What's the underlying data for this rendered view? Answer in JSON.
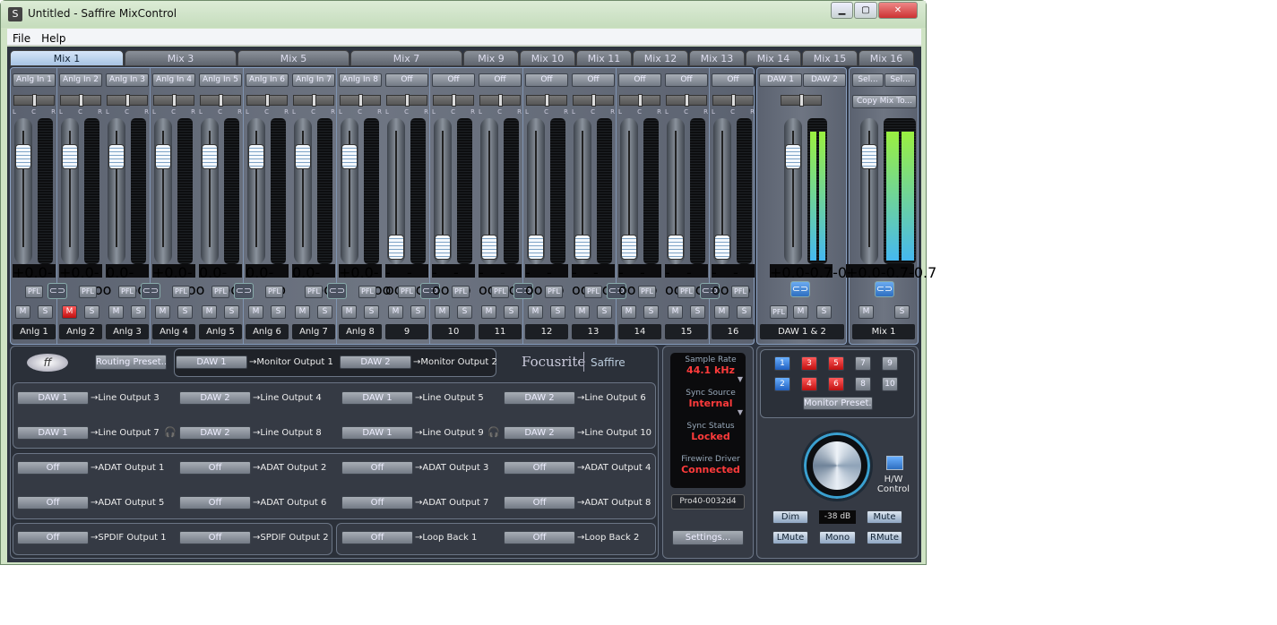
{
  "window": {
    "title": "Untitled - Saffire MixControl",
    "icon": "S",
    "min": "▁",
    "max": "▢",
    "close": "✕"
  },
  "menu": [
    "File",
    "Help"
  ],
  "tabs": [
    "Mix 1",
    "Mix 3",
    "Mix 5",
    "Mix 7",
    "Mix 9",
    "Mix 10",
    "Mix 11",
    "Mix 12",
    "Mix 13",
    "Mix 14",
    "Mix 15",
    "Mix 16"
  ],
  "channels": [
    {
      "input": "Anlg In 1",
      "gain": "+0.0",
      "peak": "-oo",
      "fader": 0.78,
      "mute": false,
      "name": "Anlg 1"
    },
    {
      "input": "Anlg In 2",
      "gain": "+0.0",
      "peak": "-oo",
      "fader": 0.78,
      "mute": true,
      "name": "Anlg 2"
    },
    {
      "input": "Anlg In 3",
      "gain": "0.0",
      "peak": "-oo",
      "fader": 0.78,
      "mute": false,
      "name": "Anlg 3"
    },
    {
      "input": "Anlg In 4",
      "gain": "+0.0",
      "peak": "-oo",
      "fader": 0.78,
      "mute": false,
      "name": "Anlg 4"
    },
    {
      "input": "Anlg In 5",
      "gain": "0.0",
      "peak": "-oo",
      "fader": 0.78,
      "mute": false,
      "name": "Anlg 5"
    },
    {
      "input": "Anlg In 6",
      "gain": "0.0",
      "peak": "-oo",
      "fader": 0.78,
      "mute": false,
      "name": "Anlg 6"
    },
    {
      "input": "Anlg In 7",
      "gain": "0.0",
      "peak": "-oo",
      "fader": 0.78,
      "mute": false,
      "name": "Anlg 7"
    },
    {
      "input": "Anlg In 8",
      "gain": "+0.0",
      "peak": "-oo",
      "fader": 0.78,
      "mute": false,
      "name": "Anlg 8"
    },
    {
      "input": "Off",
      "gain": "-oo",
      "peak": "-oo",
      "fader": 0.0,
      "mute": false,
      "name": "9"
    },
    {
      "input": "Off",
      "gain": "-oo",
      "peak": "-oo",
      "fader": 0.0,
      "mute": false,
      "name": "10"
    },
    {
      "input": "Off",
      "gain": "-oo",
      "peak": "-oo",
      "fader": 0.0,
      "mute": false,
      "name": "11"
    },
    {
      "input": "Off",
      "gain": "-oo",
      "peak": "-oo",
      "fader": 0.0,
      "mute": false,
      "name": "12"
    },
    {
      "input": "Off",
      "gain": "-oo",
      "peak": "-oo",
      "fader": 0.0,
      "mute": false,
      "name": "13"
    },
    {
      "input": "Off",
      "gain": "-oo",
      "peak": "-oo",
      "fader": 0.0,
      "mute": false,
      "name": "14"
    },
    {
      "input": "Off",
      "gain": "-oo",
      "peak": "-oo",
      "fader": 0.0,
      "mute": false,
      "name": "15"
    },
    {
      "input": "Off",
      "gain": "-oo",
      "peak": "-oo",
      "fader": 0.0,
      "mute": false,
      "name": "16"
    }
  ],
  "strip_labels": {
    "pfl": "PFL",
    "m": "M",
    "s": "S",
    "l": "L",
    "c": "C",
    "r": "R",
    "link": "⊂⊃"
  },
  "daw": {
    "in1": "DAW 1",
    "in2": "DAW 2",
    "gain": "+0.0",
    "l": "-0.7",
    "r": "-0.7",
    "meter": 0.96,
    "name": "DAW 1 & 2"
  },
  "mix": {
    "sel1": "Sel...",
    "sel2": "Sel...",
    "copy": "Copy Mix To...",
    "gain": "+0.0",
    "l": "-0.7",
    "r": "-0.7",
    "meter": 0.96,
    "name": "Mix 1"
  },
  "routing": {
    "preset": "Routing Preset...",
    "brand": "Focusrite",
    "product": "Saffire",
    "monitor": [
      {
        "src": "DAW 1",
        "dst": "→Monitor Output 1"
      },
      {
        "src": "DAW 2",
        "dst": "→Monitor Output 2"
      }
    ],
    "line": [
      {
        "src": "DAW 1",
        "dst": "→Line Output 3"
      },
      {
        "src": "DAW 2",
        "dst": "→Line Output 4"
      },
      {
        "src": "DAW 1",
        "dst": "→Line Output 5"
      },
      {
        "src": "DAW 2",
        "dst": "→Line Output 6"
      },
      {
        "src": "DAW 1",
        "dst": "→Line Output 7"
      },
      {
        "src": "DAW 2",
        "dst": "→Line Output 8"
      },
      {
        "src": "DAW 1",
        "dst": "→Line Output 9"
      },
      {
        "src": "DAW 2",
        "dst": "→Line Output 10"
      }
    ],
    "adat": [
      {
        "src": "Off",
        "dst": "→ADAT Output 1"
      },
      {
        "src": "Off",
        "dst": "→ADAT Output 2"
      },
      {
        "src": "Off",
        "dst": "→ADAT Output 3"
      },
      {
        "src": "Off",
        "dst": "→ADAT Output 4"
      },
      {
        "src": "Off",
        "dst": "→ADAT Output 5"
      },
      {
        "src": "Off",
        "dst": "→ADAT Output 6"
      },
      {
        "src": "Off",
        "dst": "→ADAT Output 7"
      },
      {
        "src": "Off",
        "dst": "→ADAT Output 8"
      }
    ],
    "spdif": [
      {
        "src": "Off",
        "dst": "→SPDIF Output 1"
      },
      {
        "src": "Off",
        "dst": "→SPDIF Output 2"
      }
    ],
    "loop": [
      {
        "src": "Off",
        "dst": "→Loop Back 1"
      },
      {
        "src": "Off",
        "dst": "→Loop Back 2"
      }
    ],
    "headphone": "🎧"
  },
  "status": {
    "sample_rate_label": "Sample Rate",
    "sample_rate": "44.1 kHz",
    "sync_source_label": "Sync Source",
    "sync_source": "Internal",
    "sync_status_label": "Sync Status",
    "sync_status": "Locked",
    "driver_label": "Firewire Driver",
    "driver": "Connected",
    "device": "Pro40-0032d4",
    "settings": "Settings..."
  },
  "monitor": {
    "buttons": [
      "1",
      "2",
      "3",
      "4",
      "5",
      "6",
      "7",
      "8",
      "9",
      "10"
    ],
    "preset": "Monitor Preset...",
    "hw_control": "H/W Control",
    "dim": "Dim",
    "level": "-38 dB",
    "mute": "Mute",
    "lmute": "LMute",
    "mono": "Mono",
    "rmute": "RMute"
  },
  "colors": {
    "accent": "#2e6fc0",
    "alert": "#ff3b3b",
    "panel": "#353a44"
  }
}
